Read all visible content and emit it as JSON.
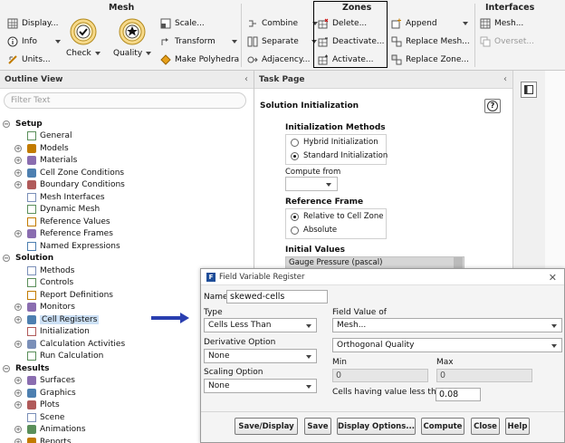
{
  "ribbon": {
    "groups": {
      "mesh": "Mesh",
      "zones": "Zones",
      "interfaces": "Interfaces"
    },
    "display": "Display...",
    "info": "Info",
    "units": "Units...",
    "check": "Check",
    "quality": "Quality",
    "scale": "Scale...",
    "transform": "Transform",
    "make_polyhedra": "Make Polyhedra",
    "combine": "Combine",
    "separate": "Separate",
    "adjacency": "Adjacency...",
    "delete": "Delete...",
    "deactivate": "Deactivate...",
    "activate": "Activate...",
    "append": "Append",
    "replace_mesh": "Replace Mesh...",
    "replace_zone": "Replace Zone...",
    "interface_mesh": "Mesh...",
    "overset": "Overset..."
  },
  "outline": {
    "title": "Outline View",
    "filter_placeholder": "Filter Text",
    "items": [
      {
        "label": "Setup",
        "section": true
      },
      {
        "label": "General"
      },
      {
        "label": "Models"
      },
      {
        "label": "Materials"
      },
      {
        "label": "Cell Zone Conditions"
      },
      {
        "label": "Boundary Conditions"
      },
      {
        "label": "Mesh Interfaces"
      },
      {
        "label": "Dynamic Mesh"
      },
      {
        "label": "Reference Values"
      },
      {
        "label": "Reference Frames"
      },
      {
        "label": "Named Expressions"
      },
      {
        "label": "Solution",
        "section": true
      },
      {
        "label": "Methods"
      },
      {
        "label": "Controls"
      },
      {
        "label": "Report Definitions"
      },
      {
        "label": "Monitors"
      },
      {
        "label": "Cell Registers"
      },
      {
        "label": "Initialization"
      },
      {
        "label": "Calculation Activities"
      },
      {
        "label": "Run Calculation"
      },
      {
        "label": "Results",
        "section": true
      },
      {
        "label": "Surfaces"
      },
      {
        "label": "Graphics"
      },
      {
        "label": "Plots"
      },
      {
        "label": "Scene"
      },
      {
        "label": "Animations"
      },
      {
        "label": "Reports"
      }
    ]
  },
  "task_page": {
    "title": "Task Page",
    "heading": "Solution Initialization",
    "init_methods_label": "Initialization Methods",
    "hybrid": "Hybrid  Initialization",
    "standard": "Standard Initialization",
    "compute_from": "Compute from",
    "reference_frame": "Reference Frame",
    "relative": "Relative to Cell Zone",
    "absolute": "Absolute",
    "initial_values": "Initial Values",
    "gauge_pressure": "Gauge Pressure (pascal)"
  },
  "dialog": {
    "title": "Field Variable Register",
    "name_label": "Name",
    "name_value": "skewed-cells",
    "type_label": "Type",
    "type_value": "Cells Less Than",
    "derivative_label": "Derivative Option",
    "derivative_value": "None",
    "scaling_label": "Scaling Option",
    "scaling_value": "None",
    "field_value_label": "Field Value of",
    "field_category": "Mesh...",
    "field_variable": "Orthogonal Quality",
    "min_label": "Min",
    "min_value": "0",
    "max_label": "Max",
    "max_value": "0",
    "threshold_label": "Cells having value less than",
    "threshold_value": "0.08",
    "buttons": {
      "save_display": "Save/Display",
      "save": "Save",
      "display_options": "Display Options...",
      "compute": "Compute",
      "close": "Close",
      "help": "Help"
    }
  },
  "colors": {
    "accent": "#1f4e99",
    "arrow": "#2a3fb0",
    "selection": "#cce0f5"
  }
}
